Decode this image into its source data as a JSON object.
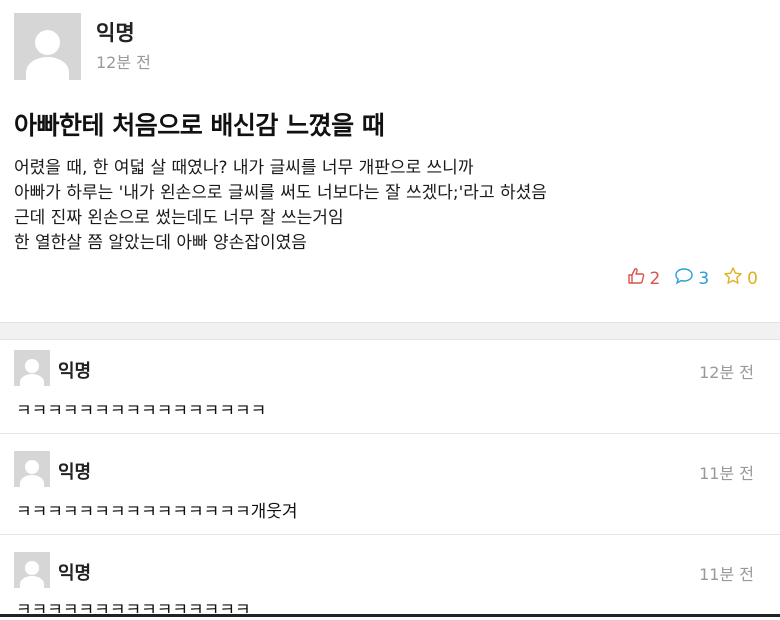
{
  "post": {
    "author": "익명",
    "time": "12분 전",
    "title": "아빠한테 처음으로 배신감 느꼈을 때",
    "body_lines": [
      "어렸을 때, 한 여덟 살 때였나? 내가 글씨를 너무 개판으로 쓰니까",
      "아빠가 하루는 '내가 왼손으로 글씨를 써도 너보다는 잘 쓰겠다;'라고 하셨음",
      "근데 진짜 왼손으로 썼는데도 너무 잘 쓰는거임",
      "한 열한살 쯤 알았는데 아빠 양손잡이였음"
    ],
    "stats": {
      "likes": "2",
      "comments": "3",
      "favorites": "0"
    },
    "colors": {
      "like": "#d9534f",
      "comment": "#2a9fd6",
      "favorite": "#e0b020"
    }
  },
  "comments": [
    {
      "author": "익명",
      "time": "12분 전",
      "text": "ㅋㅋㅋㅋㅋㅋㅋㅋㅋㅋㅋㅋㅋㅋㅋㅋ"
    },
    {
      "author": "익명",
      "time": "11분 전",
      "text": "ㅋㅋㅋㅋㅋㅋㅋㅋㅋㅋㅋㅋㅋㅋㅋ개웃겨"
    },
    {
      "author": "익명",
      "time": "11분 전",
      "text": "ㅋㅋㅋㅋㅋㅋㅋㅋㅋㅋㅋㅋㅋㅋㅋ"
    }
  ]
}
